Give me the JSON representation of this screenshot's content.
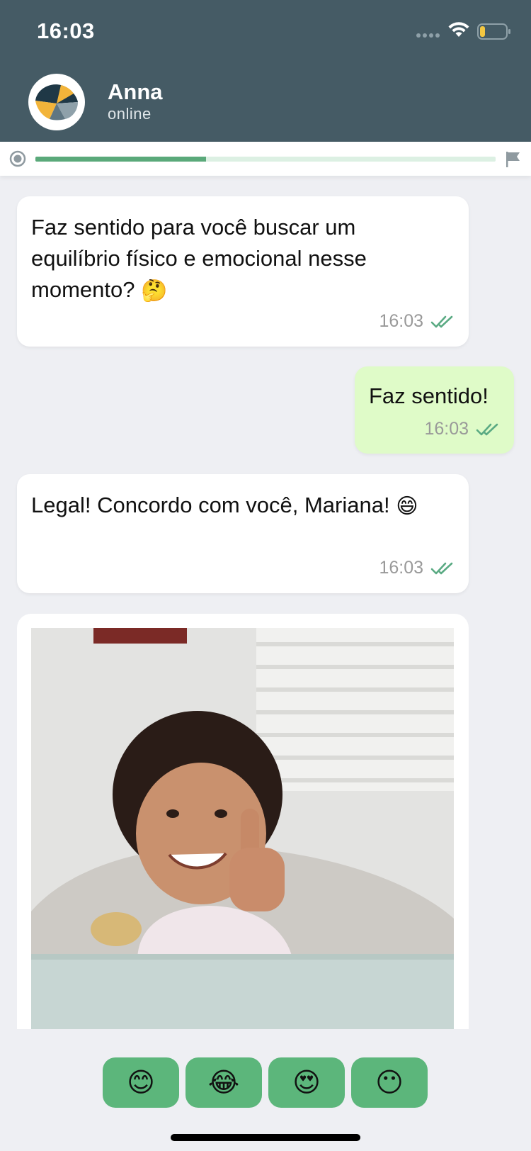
{
  "status_bar": {
    "time": "16:03",
    "battery_fill": 0.2
  },
  "contact": {
    "name": "Anna",
    "status": "online"
  },
  "progress": {
    "fraction": 0.37
  },
  "messages": [
    {
      "direction": "in",
      "text": "Faz sentido para você buscar um equilíbrio físico e emocional nesse momento?",
      "emoji": "🤔",
      "time": "16:03"
    },
    {
      "direction": "out",
      "text": "Faz sentido!",
      "time": "16:03"
    },
    {
      "direction": "in",
      "text": "Legal! Concordo com você, Mariana!",
      "emoji": "😄",
      "time": "16:03"
    }
  ],
  "reactions": [
    "😊",
    "😂",
    "😍",
    "😶"
  ],
  "colors": {
    "header": "#455b65",
    "accent_green": "#5cb67b",
    "progress_fill": "#5aa97a",
    "outgoing_bubble": "#dffbc8",
    "read_ticks": "#5aaa83"
  }
}
